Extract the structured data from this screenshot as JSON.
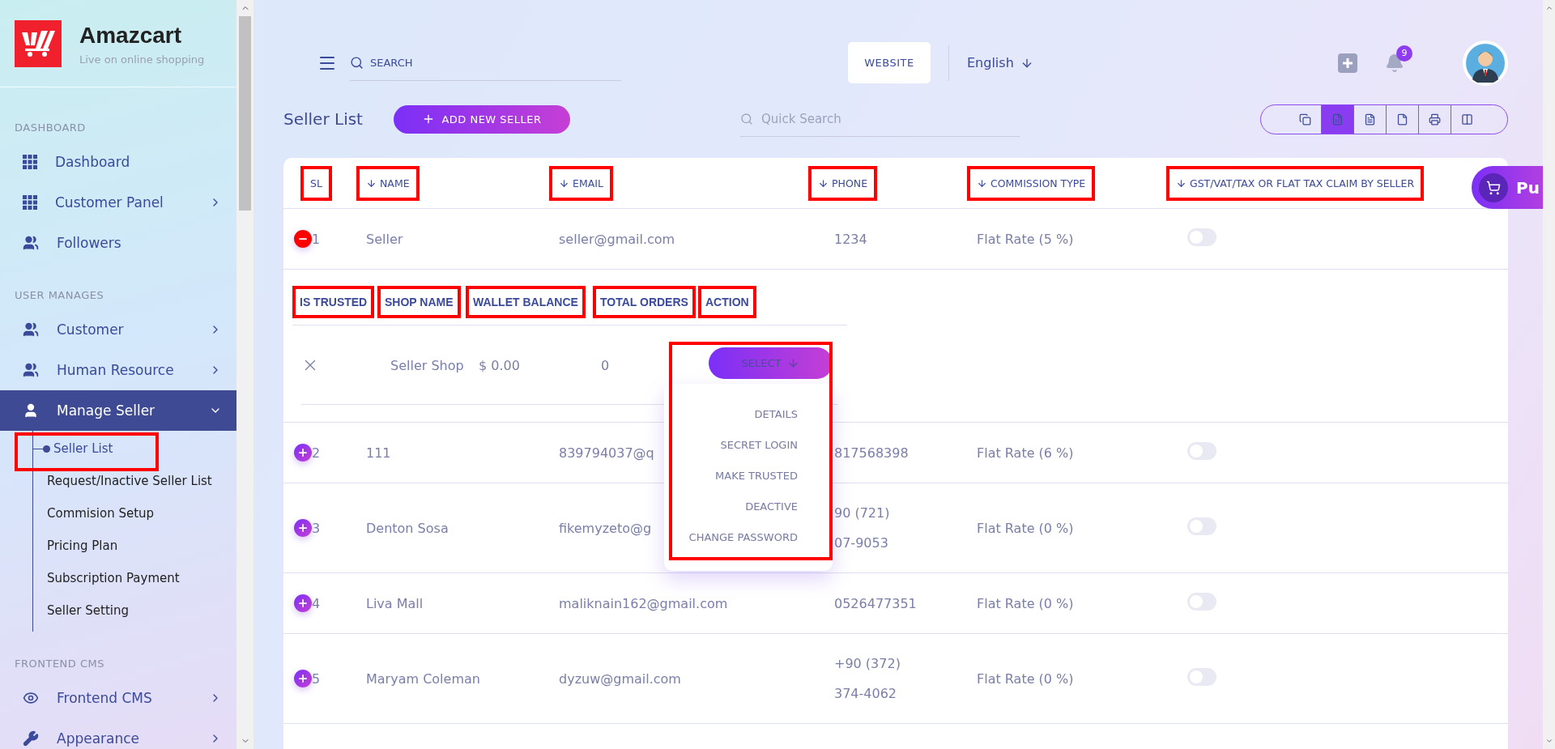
{
  "brand": {
    "name": "Amazcart",
    "tagline": "Live on online shopping"
  },
  "sidebar": {
    "sections": [
      {
        "title": "DASHBOARD",
        "items": [
          {
            "label": "Dashboard",
            "kind": "grid",
            "selected": false
          },
          {
            "label": "Customer Panel",
            "kind": "grid",
            "expanded": false,
            "selected": false
          },
          {
            "label": "Followers",
            "kind": "users",
            "selected": false
          }
        ]
      },
      {
        "title": "USER MANAGES",
        "items": [
          {
            "label": "Customer",
            "kind": "users",
            "expanded": false,
            "selected": false
          },
          {
            "label": "Human Resource",
            "kind": "users",
            "expanded": false,
            "selected": false
          },
          {
            "label": "Manage Seller",
            "kind": "user",
            "expanded": true,
            "selected": true,
            "children": [
              {
                "label": "Seller List",
                "selected": true,
                "highlighted": true
              },
              {
                "label": "Request/Inactive Seller List",
                "selected": false,
                "highlighted": false
              },
              {
                "label": "Commision Setup",
                "selected": false,
                "highlighted": false
              },
              {
                "label": "Pricing Plan",
                "selected": false,
                "highlighted": false
              },
              {
                "label": "Subscription Payment",
                "selected": false,
                "highlighted": false
              },
              {
                "label": "Seller Setting",
                "selected": false,
                "highlighted": false
              }
            ]
          }
        ]
      },
      {
        "title": "FRONTEND CMS",
        "items": [
          {
            "label": "Frontend CMS",
            "kind": "eye",
            "expanded": false,
            "selected": false
          },
          {
            "label": "Appearance",
            "kind": "wrench",
            "expanded": false,
            "selected": false
          }
        ]
      }
    ]
  },
  "header": {
    "search": {
      "placeholder": "SEARCH"
    },
    "website_button": "WEBSITE",
    "language": "English",
    "notification_count": "9"
  },
  "page": {
    "title": "Seller List",
    "add_button": "ADD NEW SELLER",
    "quick_search": {
      "placeholder": "Quick Search"
    },
    "export_tools": [
      {
        "kind": "copy",
        "selected": false
      },
      {
        "kind": "excel",
        "selected": true
      },
      {
        "kind": "csv",
        "selected": false
      },
      {
        "kind": "pdf",
        "selected": false
      },
      {
        "kind": "print",
        "selected": false
      },
      {
        "kind": "columns",
        "selected": false
      }
    ]
  },
  "table": {
    "columns": [
      {
        "label": "SL",
        "sortable": false,
        "highlighted": true
      },
      {
        "label": "NAME",
        "sortable": true,
        "highlighted": true
      },
      {
        "label": "EMAIL",
        "sortable": true,
        "highlighted": true
      },
      {
        "label": "PHONE",
        "sortable": true,
        "highlighted": true
      },
      {
        "label": "COMMISSION TYPE",
        "sortable": true,
        "highlighted": true
      },
      {
        "label": "GST/VAT/TAX OR FLAT TAX CLAIM BY SELLER",
        "sortable": true,
        "highlighted": true
      }
    ],
    "rows": [
      {
        "sl": "1",
        "name": "Seller",
        "email": "seller@gmail.com",
        "phone": [
          "1234"
        ],
        "commission": "Flat Rate (5 %)",
        "tax_claim": false,
        "expanded": true,
        "detail": {
          "columns": [
            {
              "label": "IS TRUSTED",
              "highlighted": true
            },
            {
              "label": "SHOP NAME",
              "highlighted": true
            },
            {
              "label": "WALLET BALANCE",
              "highlighted": true
            },
            {
              "label": "TOTAL ORDERS",
              "highlighted": true
            },
            {
              "label": "ACTION",
              "highlighted": true
            }
          ],
          "is_trusted": false,
          "shop_name": "Seller Shop",
          "wallet_balance": "$ 0.00",
          "total_orders": "0",
          "action": {
            "label": "SELECT",
            "open": true,
            "highlighted": true,
            "items": [
              "DETAILS",
              "SECRET LOGIN",
              "MAKE TRUSTED",
              "DEACTIVE",
              "CHANGE PASSWORD"
            ]
          }
        }
      },
      {
        "sl": "2",
        "name": "111",
        "email": "839794037@q",
        "phone": [
          "817568398"
        ],
        "commission": "Flat Rate (6 %)",
        "tax_claim": false,
        "expanded": false
      },
      {
        "sl": "3",
        "name": "Denton Sosa",
        "email": "fikemyzeto@g",
        "phone": [
          "90 (721)",
          "07-9053"
        ],
        "commission": "Flat Rate (0 %)",
        "tax_claim": false,
        "expanded": false
      },
      {
        "sl": "4",
        "name": "Liva Mall",
        "email": "maliknain162@gmail.com",
        "phone": [
          "0526477351"
        ],
        "commission": "Flat Rate (0 %)",
        "tax_claim": false,
        "expanded": false
      },
      {
        "sl": "5",
        "name": "Maryam Coleman",
        "email": "dyzuw@gmail.com",
        "phone": [
          "+90 (372)",
          "374-4062"
        ],
        "commission": "Flat Rate (0 %)",
        "tax_claim": false,
        "expanded": false
      }
    ]
  },
  "float_button": {
    "label": "Pu"
  }
}
